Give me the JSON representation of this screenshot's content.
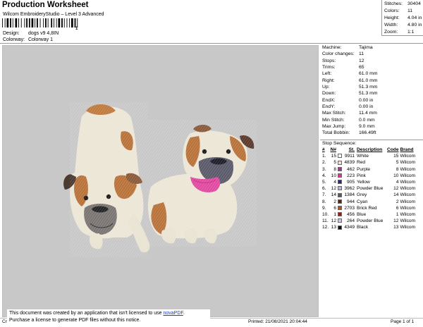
{
  "header": {
    "title": "Production Worksheet",
    "subtitle": "Wilcom EmbroideryStudio – Level 3 Advanced",
    "barcode_number": "1",
    "design_label": "Design:",
    "design_value": "dogs v9 4,8IN",
    "colorway_label": "Colorway:",
    "colorway_value": "Colorway 1"
  },
  "summary": [
    {
      "label": "Stitches:",
      "value": "30404"
    },
    {
      "label": "Colors:",
      "value": "11"
    },
    {
      "label": "Height:",
      "value": "4.04 in"
    },
    {
      "label": "Width:",
      "value": "4.80 in"
    },
    {
      "label": "Zoom:",
      "value": "1:1"
    }
  ],
  "machine": [
    {
      "label": "Machine:",
      "value": "Tajima"
    },
    {
      "label": "Color changes:",
      "value": "11"
    },
    {
      "label": "Stops:",
      "value": "12"
    },
    {
      "label": "Trims:",
      "value": "65"
    },
    {
      "label": "Left:",
      "value": "61.0 mm"
    },
    {
      "label": "Right:",
      "value": "61.0 mm"
    },
    {
      "label": "Up:",
      "value": "51.3 mm"
    },
    {
      "label": "Down:",
      "value": "51.3 mm"
    },
    {
      "label": "EndX:",
      "value": "0.00 in"
    },
    {
      "label": "EndY:",
      "value": "0.00 in"
    },
    {
      "label": "Max Stitch:",
      "value": "11.4 mm"
    },
    {
      "label": "Min Stitch:",
      "value": "0.0 mm"
    },
    {
      "label": "Max Jump:",
      "value": "9.0 mm"
    },
    {
      "label": "Total Bobbin:",
      "value": "166.49ft"
    }
  ],
  "stop_sequence": {
    "title": "Stop Sequence:",
    "headers": [
      "#",
      "N#",
      "St.",
      "Description",
      "Code",
      "Brand"
    ],
    "rows": [
      {
        "num": "1.",
        "n": "15",
        "color": "#ffffff",
        "st": "9911",
        "desc": "White",
        "code": "15",
        "brand": "Wilcom"
      },
      {
        "num": "2.",
        "n": "5",
        "color": "#f4dcd6",
        "st": "4839",
        "desc": "Red",
        "code": "5",
        "brand": "Wilcom"
      },
      {
        "num": "3.",
        "n": "8",
        "color": "#9b3a8c",
        "st": "462",
        "desc": "Purple",
        "code": "8",
        "brand": "Wilcom"
      },
      {
        "num": "4.",
        "n": "10",
        "color": "#e6348c",
        "st": "223",
        "desc": "Pink",
        "code": "10",
        "brand": "Wilcom"
      },
      {
        "num": "5.",
        "n": "4",
        "color": "#2a2a6a",
        "st": "905",
        "desc": "Yellow",
        "code": "4",
        "brand": "Wilcom"
      },
      {
        "num": "6.",
        "n": "12",
        "color": "#b9b6d6",
        "st": "3962",
        "desc": "Powder Blue",
        "code": "12",
        "brand": "Wilcom"
      },
      {
        "num": "7.",
        "n": "14",
        "color": "#5a5a5a",
        "st": "1384",
        "desc": "Grey",
        "code": "14",
        "brand": "Wilcom"
      },
      {
        "num": "8.",
        "n": "2",
        "color": "#5a2418",
        "st": "944",
        "desc": "Cyan",
        "code": "2",
        "brand": "Wilcom"
      },
      {
        "num": "9.",
        "n": "6",
        "color": "#a8552a",
        "st": "2703",
        "desc": "Brick Red",
        "code": "6",
        "brand": "Wilcom"
      },
      {
        "num": "10.",
        "n": "1",
        "color": "#a01818",
        "st": "456",
        "desc": "Blue",
        "code": "1",
        "brand": "Wilcom"
      },
      {
        "num": "11.",
        "n": "12",
        "color": "#c8c6e2",
        "st": "264",
        "desc": "Powder Blue",
        "code": "12",
        "brand": "Wilcom"
      },
      {
        "num": "12.",
        "n": "13",
        "color": "#111111",
        "st": "4349",
        "desc": "Black",
        "code": "13",
        "brand": "Wilcom"
      }
    ]
  },
  "footer": {
    "notice_line1": "This document was created by an application that isn't licensed to use ",
    "notice_link": "novaPDF",
    "notice_line1_end": ".",
    "notice_line2": "Purchase a license to generate PDF files without this notice.",
    "left": "Cr",
    "printed": "Printed: 21/08/2021 20:04:44",
    "page": "Page 1 of 1"
  },
  "colors": {
    "canvas_bg": "#c8c8c8",
    "fur_tan": "#b8723a",
    "fur_white": "#ece6d6",
    "tongue": "#e04aa0",
    "link": "#1a3fb8"
  }
}
